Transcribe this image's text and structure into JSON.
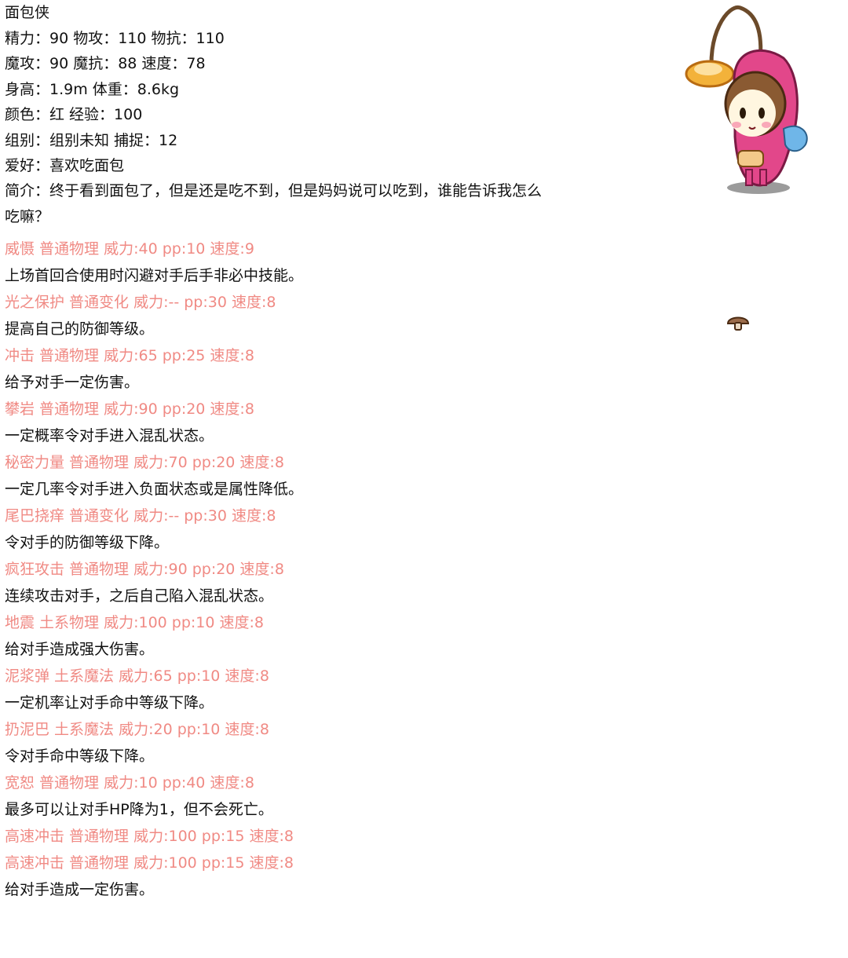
{
  "profile": {
    "name": "面包侠",
    "stats_line1": "精力：90 物攻：110 物抗：110",
    "stats_line2": "魔攻：90 魔抗：88 速度：78",
    "body_line": "身高：1.9m 体重：8.6kg",
    "color_line": "颜色：红 经验：100",
    "group_line": "组别：组别未知 捕捉：12",
    "hobby_line": "爱好：喜欢吃面包",
    "intro_line": "简介：终于看到面包了，但是还是吃不到，但是妈妈说可以吃到，谁能告诉我怎么吃嘛？"
  },
  "skill_color": "#f08a84",
  "skills": [
    {
      "name": "威慑 普通物理 威力:40 pp:10 速度:9",
      "desc": "上场首回合使用时闪避对手后手非必中技能。"
    },
    {
      "name": "光之保护 普通变化 威力:-- pp:30 速度:8",
      "desc": "提高自己的防御等级。"
    },
    {
      "name": "冲击 普通物理 威力:65 pp:25 速度:8",
      "desc": "给予对手一定伤害。"
    },
    {
      "name": "攀岩 普通物理 威力:90 pp:20 速度:8",
      "desc": "一定概率令对手进入混乱状态。"
    },
    {
      "name": "秘密力量 普通物理 威力:70 pp:20 速度:8",
      "desc": "一定几率令对手进入负面状态或是属性降低。"
    },
    {
      "name": "尾巴挠痒 普通变化 威力:-- pp:30 速度:8",
      "desc": "令对手的防御等级下降。"
    },
    {
      "name": "疯狂攻击 普通物理 威力:90 pp:20 速度:8",
      "desc": "连续攻击对手，之后自己陷入混乱状态。"
    },
    {
      "name": "地震 土系物理 威力:100 pp:10 速度:8",
      "desc": "给对手造成强大伤害。"
    },
    {
      "name": "泥浆弹 土系魔法 威力:65 pp:10 速度:8",
      "desc": "一定机率让对手命中等级下降。"
    },
    {
      "name": "扔泥巴 土系魔法 威力:20 pp:10 速度:8",
      "desc": "令对手命中等级下降。"
    },
    {
      "name": "宽恕 普通物理 威力:10 pp:40 速度:8",
      "desc": "最多可以让对手HP降为1，但不会死亡。"
    },
    {
      "name": "高速冲击 普通物理 威力:100 pp:15 速度:8",
      "desc": ""
    },
    {
      "name": "高速冲击 普通物理 威力:100 pp:15 速度:8",
      "desc": "给对手造成一定伤害。"
    }
  ]
}
